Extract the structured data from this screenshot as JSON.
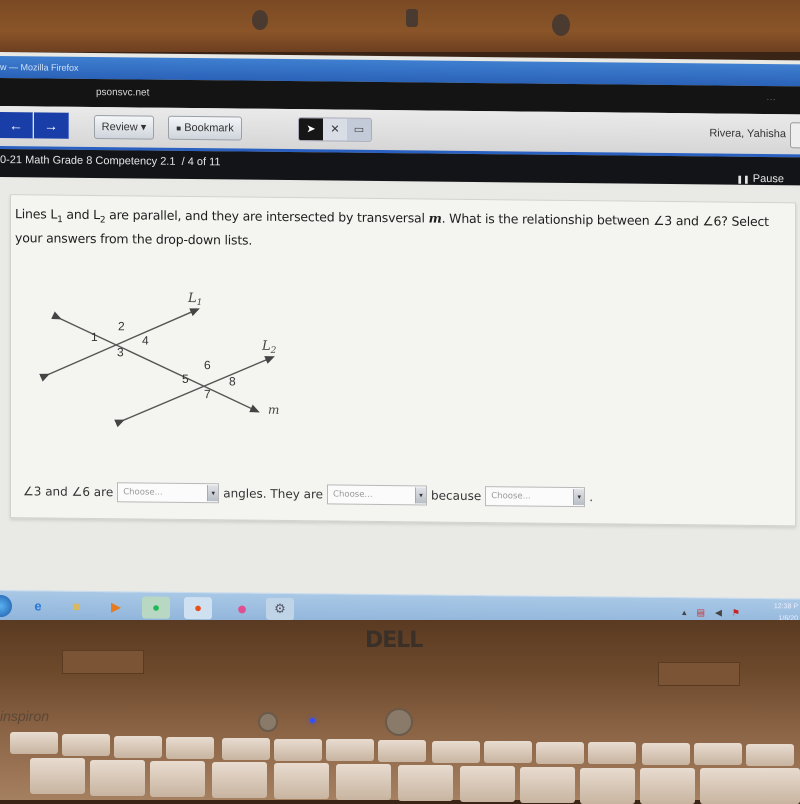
{
  "browser": {
    "window_title": "w — Mozilla Firefox",
    "url": "psonsvc.net",
    "url_menu": "…"
  },
  "toolbar": {
    "back_label": "←",
    "forward_label": "→",
    "review_label": "Review ▾",
    "bookmark_label": "Bookmark",
    "bookmark_glyph": "■",
    "pointer_tool": "➤",
    "eliminate_tool": "✕",
    "notepad_tool": "▭",
    "user_name": "Rivera, Yahisha"
  },
  "testbar": {
    "test_title": "0-21 Math Grade 8 Competency 2.1",
    "progress": "/ 4 of 11",
    "pause_label": "Pause",
    "pause_glyph": "❚❚"
  },
  "question": {
    "text_part1": "Lines L",
    "sub1": "1",
    "text_part2": " and L",
    "sub2": "2",
    "text_part3": " are parallel, and they are intersected by transversal ",
    "transversal": "m",
    "text_part4": ". What is the relationship between ∠3 and ∠6? Select your answers from the drop-down lists."
  },
  "diagram": {
    "line1_label": "L",
    "line1_sub": "1",
    "line2_label": "L",
    "line2_sub": "2",
    "transversal_label": "m",
    "angles": [
      "1",
      "2",
      "3",
      "4",
      "5",
      "6",
      "7",
      "8"
    ]
  },
  "answer": {
    "prefix": "∠3 and ∠6 are",
    "select1_value": "Choose...",
    "middle1": "angles. They are",
    "select2_value": "Choose...",
    "middle2": "because",
    "select3_value": "Choose...",
    "suffix": ".",
    "arrow": "▾"
  },
  "taskbar": {
    "icons": [
      "start-orb",
      "internet-explorer",
      "file-explorer",
      "media-player",
      "spotify",
      "firefox",
      "app-pink",
      "app-system"
    ],
    "clock_time": "12:38 P",
    "clock_date": "1/6/20"
  },
  "laptop": {
    "brand_logo": "DELL",
    "model": "inspiron"
  }
}
